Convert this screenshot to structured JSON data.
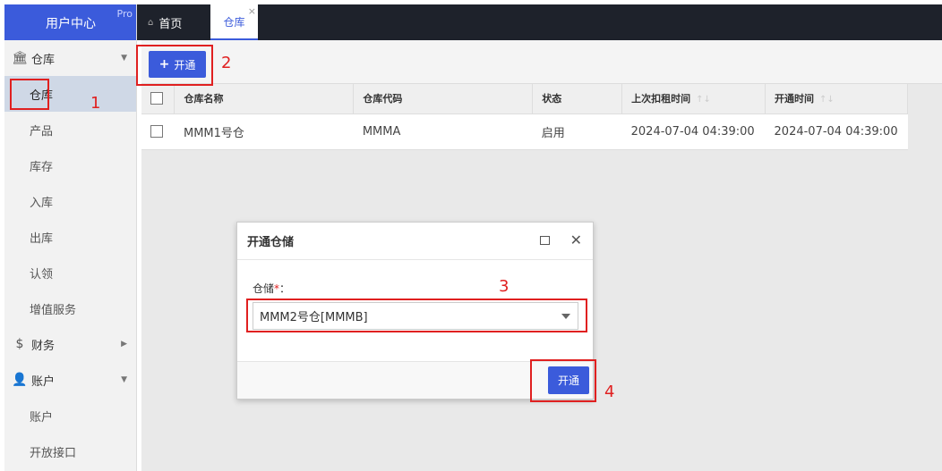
{
  "sidebar": {
    "brand": "用户中心",
    "badge": "Pro",
    "groups": [
      {
        "label": "仓库",
        "icon": "bank-icon",
        "arrow": "▼",
        "items": [
          "仓库",
          "产品",
          "库存",
          "入库",
          "出库",
          "认领",
          "增值服务"
        ]
      },
      {
        "label": "财务",
        "icon": "dollar-icon",
        "arrow": "▶",
        "items": []
      },
      {
        "label": "账户",
        "icon": "user-icon",
        "arrow": "▼",
        "items": [
          "账户",
          "开放接口"
        ]
      }
    ],
    "active_item": "仓库"
  },
  "tabs": {
    "home": "首页",
    "current": "仓库",
    "close": "×"
  },
  "toolbar": {
    "open_label": "开通"
  },
  "table": {
    "columns": [
      "仓库名称",
      "仓库代码",
      "状态",
      "上次扣租时间",
      "开通时间"
    ],
    "rows": [
      [
        "MMM1号仓",
        "MMMA",
        "启用",
        "2024-07-04 04:39:00",
        "2024-07-04 04:39:00"
      ]
    ]
  },
  "dialog": {
    "title": "开通仓储",
    "field_label": "仓储",
    "required_mark": "*",
    "colon": "：",
    "selected_value": "MMM2号仓[MMMB]",
    "submit_label": "开通"
  },
  "annotations": [
    "1",
    "2",
    "3",
    "4"
  ],
  "colors": {
    "brand": "#3b5bdb",
    "topbar": "#1e222b",
    "annotation": "#e02020",
    "active_menu": "#cfd8e6"
  }
}
